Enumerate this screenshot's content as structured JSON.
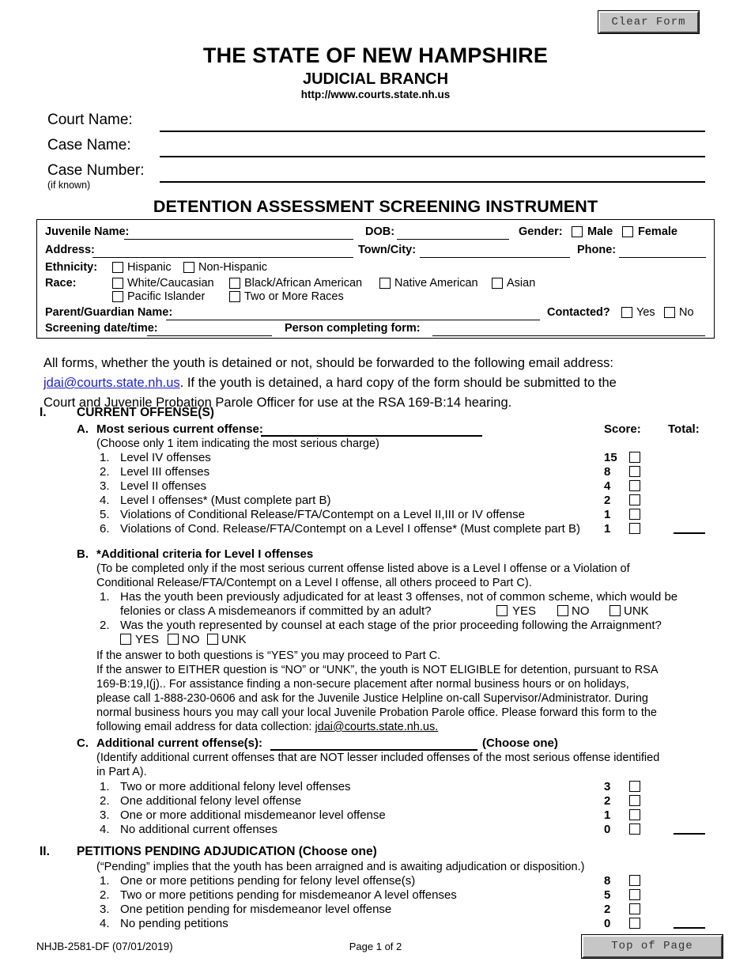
{
  "buttons": {
    "clear_form": "Clear Form",
    "top_of_page": "Top of Page"
  },
  "header": {
    "state_title": "THE STATE OF NEW HAMPSHIRE",
    "branch_title": "JUDICIAL BRANCH",
    "url": "http://www.courts.state.nh.us"
  },
  "case_fields": {
    "court_name_label": "Court Name:",
    "case_name_label": "Case Name:",
    "case_number_label": "Case Number:",
    "case_number_sub": "(if known)",
    "court_name_value": "",
    "case_name_value": "",
    "case_number_value": ""
  },
  "form_title": "DETENTION ASSESSMENT SCREENING INSTRUMENT",
  "info_box": {
    "juvenile_name_label": "Juvenile Name:",
    "dob_label": "DOB:",
    "gender_label": "Gender:",
    "gender_male": "Male",
    "gender_female": "Female",
    "address_label": "Address:",
    "town_city_label": "Town/City:",
    "phone_label": "Phone:",
    "ethnicity_label": "Ethnicity:",
    "ethnicity_options": [
      "Hispanic",
      "Non-Hispanic"
    ],
    "race_label": "Race:",
    "race_options_row1": [
      "White/Caucasian",
      "Black/African American",
      "Native American",
      "Asian"
    ],
    "race_options_row2": [
      "Pacific Islander",
      "Two or More Races"
    ],
    "parent_guardian_label": "Parent/Guardian Name:",
    "contacted_label": "Contacted?",
    "contacted_yes": "Yes",
    "contacted_no": "No",
    "screening_datetime_label": "Screening date/time:",
    "person_completing_label": "Person completing form:"
  },
  "intro": {
    "line1": "All forms, whether the youth is detained or not, should be forwarded to the following email address:",
    "email": "jdai@courts.state.nh.us",
    "line2a": ".  If the youth is detained, a hard copy of the form should be submitted to the",
    "line3": "Court and Juvenile Probation Parole Officer for use at the RSA 169-B:14 hearing."
  },
  "columns": {
    "score": "Score:",
    "total": "Total:"
  },
  "section1": {
    "numeral": "I.",
    "title": "CURRENT OFFENSE(S)",
    "partA": {
      "letter": "A.",
      "title": "Most serious current offense:",
      "note": "(Choose only 1 item indicating the most serious charge)",
      "items": [
        {
          "num": "1.",
          "text": "Level IV offenses",
          "score": "15"
        },
        {
          "num": "2.",
          "text": "Level III offenses",
          "score": "8"
        },
        {
          "num": "3.",
          "text": "Level II offenses",
          "score": "4"
        },
        {
          "num": "4.",
          "text": "Level I offenses* (Must complete part B)",
          "score": "2"
        },
        {
          "num": "5.",
          "text": "Violations of Conditional Release/FTA/Contempt on a Level II,III or IV offense",
          "score": "1"
        },
        {
          "num": "6.",
          "text": "Violations of Cond. Release/FTA/Contempt on a Level I offense* (Must complete part B)",
          "score": "1"
        }
      ]
    },
    "partB": {
      "letter": "B.",
      "title": "*Additional criteria for Level I offenses",
      "note_line1": "(To be completed only if the most serious current offense listed above is a Level I offense or a Violation of",
      "note_line2": "Conditional Release/FTA/Contempt on a Level I offense, all others proceed to Part C).",
      "q1_num": "1.",
      "q1_line1": "Has the youth been previously adjudicated for at least 3 offenses, not of common scheme, which would be",
      "q1_line2": "felonies or class A misdemeanors if committed by an adult?",
      "q2_num": "2.",
      "q2_text": "Was the youth represented by counsel at each stage of the prior proceeding following the Arraignment?",
      "opt_yes": "YES",
      "opt_no": "NO",
      "opt_unk": "UNK",
      "para_line1": "If the answer to both questions is “YES” you may proceed to Part C.",
      "para_line2": "If the answer to EITHER question is “NO” or “UNK”, the youth is NOT ELIGIBLE for detention, pursuant to RSA",
      "para_line3": "169-B:19,I(j).. For assistance finding a non-secure placement after normal business hours or on holidays,",
      "para_line4": "please call 1-888-230-0606 and ask for the Juvenile Justice Helpline on-call Supervisor/Administrator. During",
      "para_line5": "normal business hours you may call your local Juvenile Probation Parole office. Please forward this form to the",
      "para_line6_pre": "following email address for data collection: ",
      "para_line6_email": "jdai@courts.state.nh.us."
    },
    "partC": {
      "letter": "C.",
      "title": "Additional current offense(s):",
      "choose_one": "(Choose one)",
      "note_line1": "(Identify additional current offenses that are NOT lesser included offenses of the most serious offense identified",
      "note_line2": "in Part A).",
      "items": [
        {
          "num": "1.",
          "text": "Two or more additional felony level offenses",
          "score": "3"
        },
        {
          "num": "2.",
          "text": "One additional felony level offense",
          "score": "2"
        },
        {
          "num": "3.",
          "text": "One or more additional misdemeanor level offense",
          "score": "1"
        },
        {
          "num": "4.",
          "text": "No additional current offenses",
          "score": "0"
        }
      ]
    }
  },
  "section2": {
    "numeral": "II.",
    "title": "PETITIONS PENDING ADJUDICATION (Choose one)",
    "note": "(“Pending” implies that the youth has been arraigned and is awaiting adjudication or disposition.)",
    "items": [
      {
        "num": "1.",
        "text": "One or more petitions pending for felony level offense(s)",
        "score": "8"
      },
      {
        "num": "2.",
        "text": "Two or more petitions pending for misdemeanor A level offenses",
        "score": "5"
      },
      {
        "num": "3.",
        "text": "One petition pending for misdemeanor level offense",
        "score": "2"
      },
      {
        "num": "4.",
        "text": "No pending petitions",
        "score": "0"
      }
    ]
  },
  "footer": {
    "form_number": "NHJB-2581-DF (07/01/2019)",
    "page_label": "Page 1 of 2"
  }
}
